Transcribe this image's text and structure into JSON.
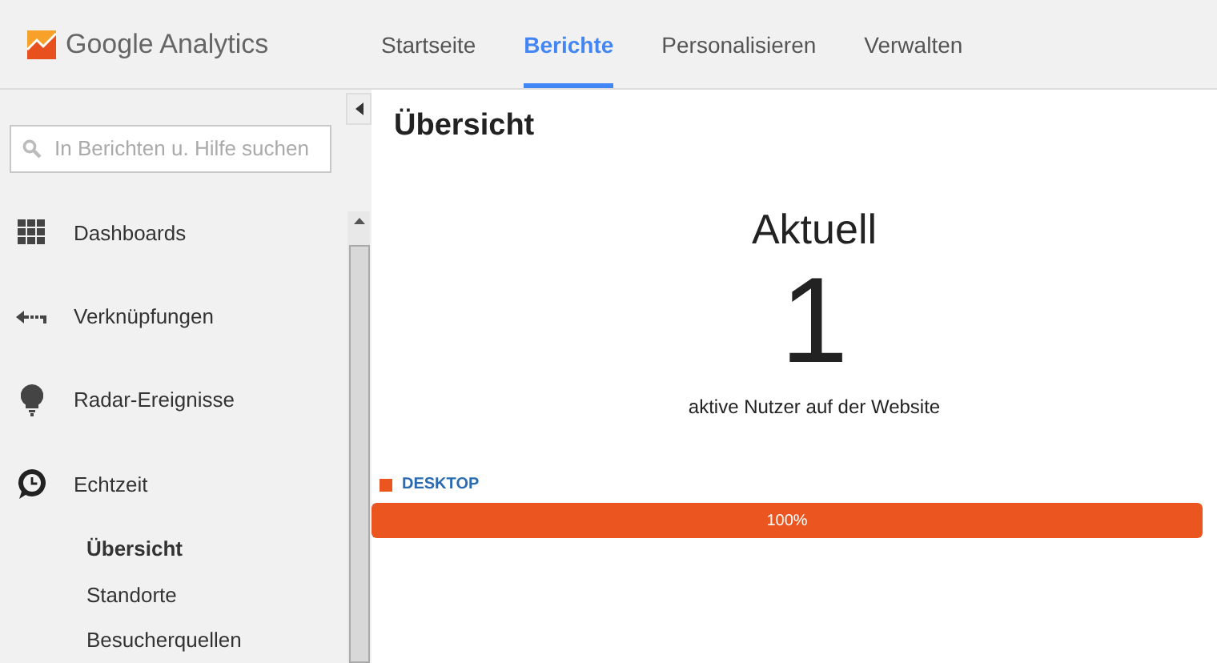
{
  "header": {
    "logo_text": "Google Analytics",
    "tabs": [
      {
        "label": "Startseite",
        "selected": false
      },
      {
        "label": "Berichte",
        "selected": true
      },
      {
        "label": "Personalisieren",
        "selected": false
      },
      {
        "label": "Verwalten",
        "selected": false
      }
    ]
  },
  "sidebar": {
    "search": {
      "placeholder": "In Berichten u. Hilfe suchen"
    },
    "items": [
      {
        "label": "Dashboards",
        "kind": "grid",
        "expanded": false
      },
      {
        "label": "Verknüpfungen",
        "kind": "shortcut",
        "expanded": false
      },
      {
        "label": "Radar-Ereignisse",
        "kind": "bulb",
        "expanded": false
      },
      {
        "label": "Echtzeit",
        "kind": "clock",
        "expanded": true,
        "children": [
          {
            "label": "Übersicht",
            "selected": true
          },
          {
            "label": "Standorte",
            "selected": false
          },
          {
            "label": "Besucherquellen",
            "selected": false
          }
        ]
      }
    ]
  },
  "main": {
    "title": "Übersicht",
    "heading": "Aktuell",
    "count": "1",
    "caption": "aktive Nutzer auf der Website",
    "devices": [
      {
        "name": "DESKTOP",
        "color": "#eb5520",
        "share": "100%",
        "level": 1
      }
    ]
  }
}
